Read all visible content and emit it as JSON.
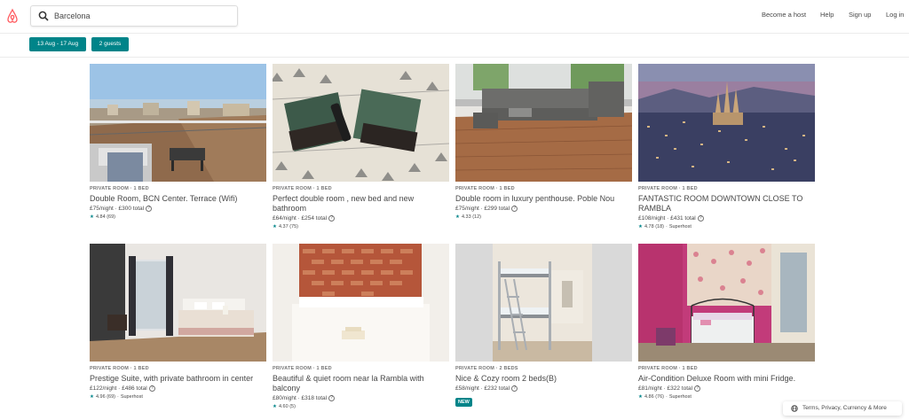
{
  "header": {
    "logo_icon": "airbnb-logo-icon",
    "search": {
      "value": "Barcelona",
      "icon": "search-icon"
    },
    "nav": {
      "become_host": "Become a host",
      "help": "Help",
      "sign_up": "Sign up",
      "log_in": "Log in"
    }
  },
  "filters": {
    "dates": "13 Aug - 17 Aug",
    "guests": "2 guests"
  },
  "colors": {
    "accent": "#008489",
    "brand": "#FF5A5F",
    "text": "#484848"
  },
  "listings": [
    {
      "kind": "PRIVATE ROOM · 1 BED",
      "title": "Double Room, BCN Center. Terrace (Wifi)",
      "price": "£75/night · £300 total",
      "rating": "4.84",
      "reviews": "(69)",
      "superhost": ""
    },
    {
      "kind": "PRIVATE ROOM · 1 BED",
      "title": "Perfect double room , new bed and new bathroom",
      "price": "£64/night · £254 total",
      "rating": "4.37",
      "reviews": "(75)",
      "superhost": ""
    },
    {
      "kind": "PRIVATE ROOM · 1 BED",
      "title": "Double room in luxury penthouse. Poble Nou",
      "price": "£75/night · £299 total",
      "rating": "4.33",
      "reviews": "(12)",
      "superhost": ""
    },
    {
      "kind": "PRIVATE ROOM · 1 BED",
      "title": "FANTASTIC ROOM DOWNTOWN CLOSE TO RAMBLA",
      "price": "£108/night · £431 total",
      "rating": "4.78",
      "reviews": "(18)",
      "superhost": "Superhost"
    },
    {
      "kind": "PRIVATE ROOM · 1 BED",
      "title": "Prestige Suite, with private bathroom in center",
      "price": "£122/night · £486 total",
      "rating": "4.96",
      "reviews": "(69)",
      "superhost": "Superhost"
    },
    {
      "kind": "PRIVATE ROOM · 1 BED",
      "title": "Beautiful & quiet room near la Rambla with balcony",
      "price": "£80/night · £318 total",
      "rating": "4.60",
      "reviews": "(5)",
      "superhost": ""
    },
    {
      "kind": "PRIVATE ROOM · 2 BEDS",
      "title": "Nice & Cozy room 2 beds(B)",
      "price": "£58/night · £232 total",
      "badge": "NEW"
    },
    {
      "kind": "PRIVATE ROOM · 1 BED",
      "title": "Air-Condition Deluxe Room with mini Fridge.",
      "price": "£81/night · £322 total",
      "rating": "4.86",
      "reviews": "(76)",
      "superhost": "Superhost"
    }
  ],
  "footer": {
    "label": "Terms, Privacy, Currency & More",
    "icon": "globe-icon"
  }
}
